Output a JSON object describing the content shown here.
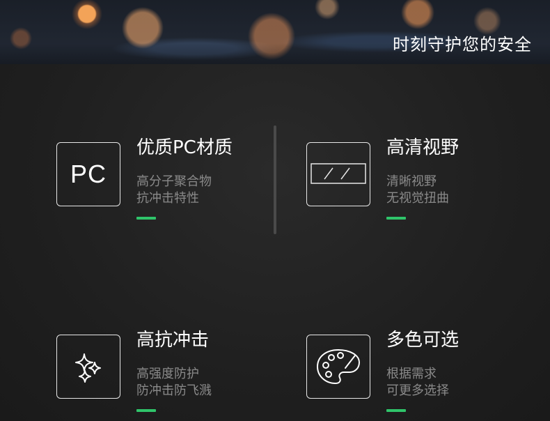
{
  "banner": {
    "title": "时刻守护您的安全"
  },
  "features": [
    {
      "title": "优质PC材质",
      "line1": "高分子聚合物",
      "line2": "抗冲击特性",
      "icon": "pc-text-icon",
      "icon_text": "PC"
    },
    {
      "title": "高清视野",
      "line1": "清晰视野",
      "line2": "无视觉扭曲",
      "icon": "lens-icon"
    },
    {
      "title": "高抗冲击",
      "line1": "高强度防护",
      "line2": "防冲击防飞溅",
      "icon": "sparkle-icon"
    },
    {
      "title": "多色可选",
      "line1": "根据需求",
      "line2": "可更多选择",
      "icon": "palette-icon"
    }
  ],
  "colors": {
    "accent": "#2fc46a",
    "background": "#1e1e1e",
    "desc": "#8a8a8a"
  }
}
